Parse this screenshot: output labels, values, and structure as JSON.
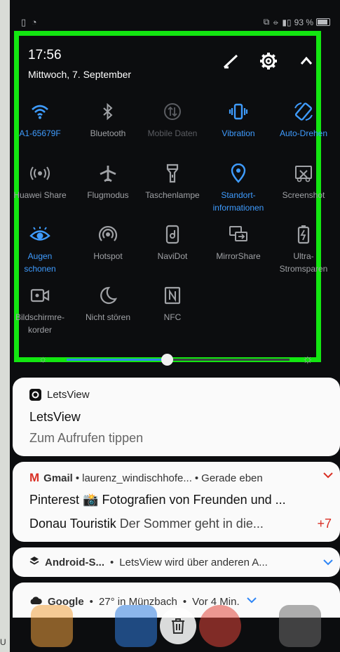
{
  "status": {
    "battery": "93 %"
  },
  "qs": {
    "time": "17:56",
    "date": "Mittwoch, 7. September",
    "tiles": [
      {
        "label": "A1-65679F",
        "icon": "wifi-icon",
        "state": "active"
      },
      {
        "label": "Bluetooth",
        "icon": "bluetooth-icon",
        "state": "off"
      },
      {
        "label": "Mobile Daten",
        "icon": "mobile-data-icon",
        "state": "disabled"
      },
      {
        "label": "Vibration",
        "icon": "vibration-icon",
        "state": "active"
      },
      {
        "label": "Auto-Drehen",
        "icon": "auto-rotate-icon",
        "state": "active"
      },
      {
        "label": "Huawei Share",
        "icon": "huawei-share-icon",
        "state": "off"
      },
      {
        "label": "Flugmodus",
        "icon": "airplane-icon",
        "state": "off"
      },
      {
        "label": "Taschenlampe",
        "icon": "flashlight-icon",
        "state": "off"
      },
      {
        "label": "Standort-\ninformationen",
        "icon": "location-icon",
        "state": "active"
      },
      {
        "label": "Screenshot",
        "icon": "screenshot-icon",
        "state": "off"
      },
      {
        "label": "Augen\nschonen",
        "icon": "eye-comfort-icon",
        "state": "active"
      },
      {
        "label": "Hotspot",
        "icon": "hotspot-icon",
        "state": "off"
      },
      {
        "label": "NaviDot",
        "icon": "navidot-icon",
        "state": "off"
      },
      {
        "label": "MirrorShare",
        "icon": "mirrorshare-icon",
        "state": "off"
      },
      {
        "label": "Ultra-\nStromsparen",
        "icon": "battery-saver-icon",
        "state": "off"
      },
      {
        "label": "Bildschirmre-\nkorder",
        "icon": "screen-recorder-icon",
        "state": "off"
      },
      {
        "label": "Nicht stören",
        "icon": "do-not-disturb-icon",
        "state": "off"
      },
      {
        "label": "NFC",
        "icon": "nfc-icon",
        "state": "off"
      }
    ],
    "brightness": 0.45
  },
  "notifications": {
    "letsview": {
      "app": "LetsView",
      "title": "LetsView",
      "text": "Zum Aufrufen tippen"
    },
    "gmail": {
      "app": "Gmail",
      "account": "laurenz_windischhofe...",
      "time": "Gerade eben",
      "line1_sender": "Pinterest",
      "line1_text": "📸 Fotografien von Freunden und ...",
      "line2_sender": "Donau Touristik",
      "line2_text": "Der Sommer geht in die...",
      "more": "+7"
    },
    "android": {
      "app": "Android-S...",
      "text": "LetsView wird über anderen A..."
    },
    "google": {
      "app": "Google",
      "text": "27° in Münzbach",
      "time": "Vor 4 Min."
    }
  },
  "colors": {
    "accent": "#3f9cff",
    "highlight": "#13e611",
    "gmail": "#d93025",
    "card_bg": "#fafafa"
  }
}
